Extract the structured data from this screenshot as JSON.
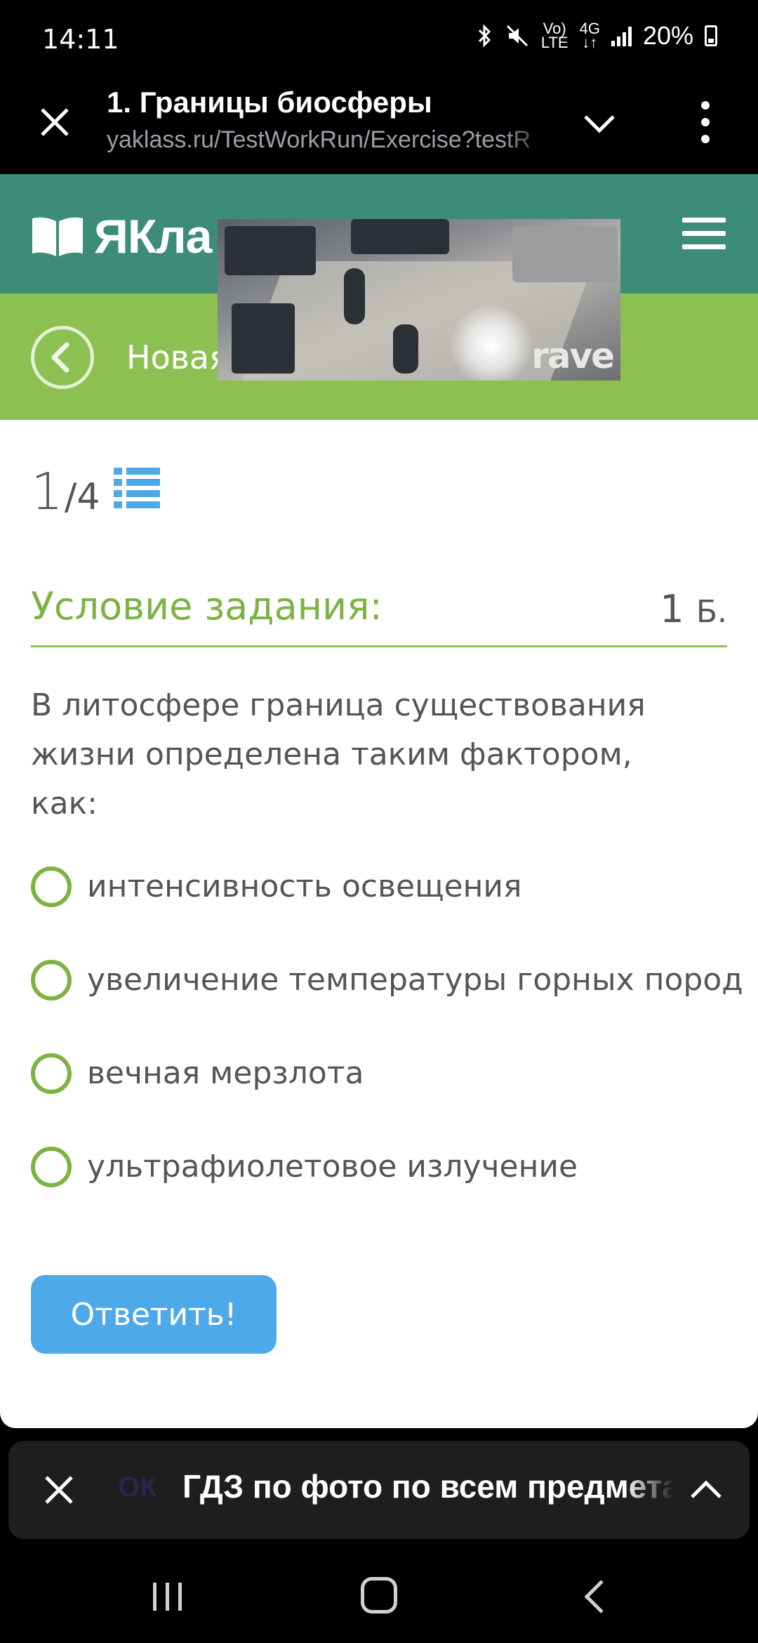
{
  "status_bar": {
    "time": "14:11",
    "network_top": "Vo)",
    "network_bottom": "LTE",
    "mobile_data": "4G",
    "battery": "20%"
  },
  "browser": {
    "title": "1. Границы биосферы",
    "url": "yaklass.ru/TestWorkRun/Exercise?testR"
  },
  "site": {
    "logo_text": "ЯКла",
    "subtitle": "Новая"
  },
  "video": {
    "logo_text": "rave"
  },
  "test": {
    "current": "1",
    "total": "/4",
    "task_label": "Условие задания:",
    "points_value": "1",
    "points_unit": "Б.",
    "question": "В литосфере граница существования жизни определена таким фактором, как:",
    "options": [
      "интенсивность освещения",
      "увеличение температуры горных пород",
      "вечная мерзлота",
      "ультрафиолетовое излучение"
    ],
    "submit_label": "Ответить!"
  },
  "banner": {
    "brand": "ОК",
    "text": "ГДЗ по фото по всем предмета"
  },
  "colors": {
    "header_teal": "#3d8c78",
    "accent_green": "#8cc152",
    "task_green": "#7cb342",
    "button_blue": "#4ea9e8"
  }
}
